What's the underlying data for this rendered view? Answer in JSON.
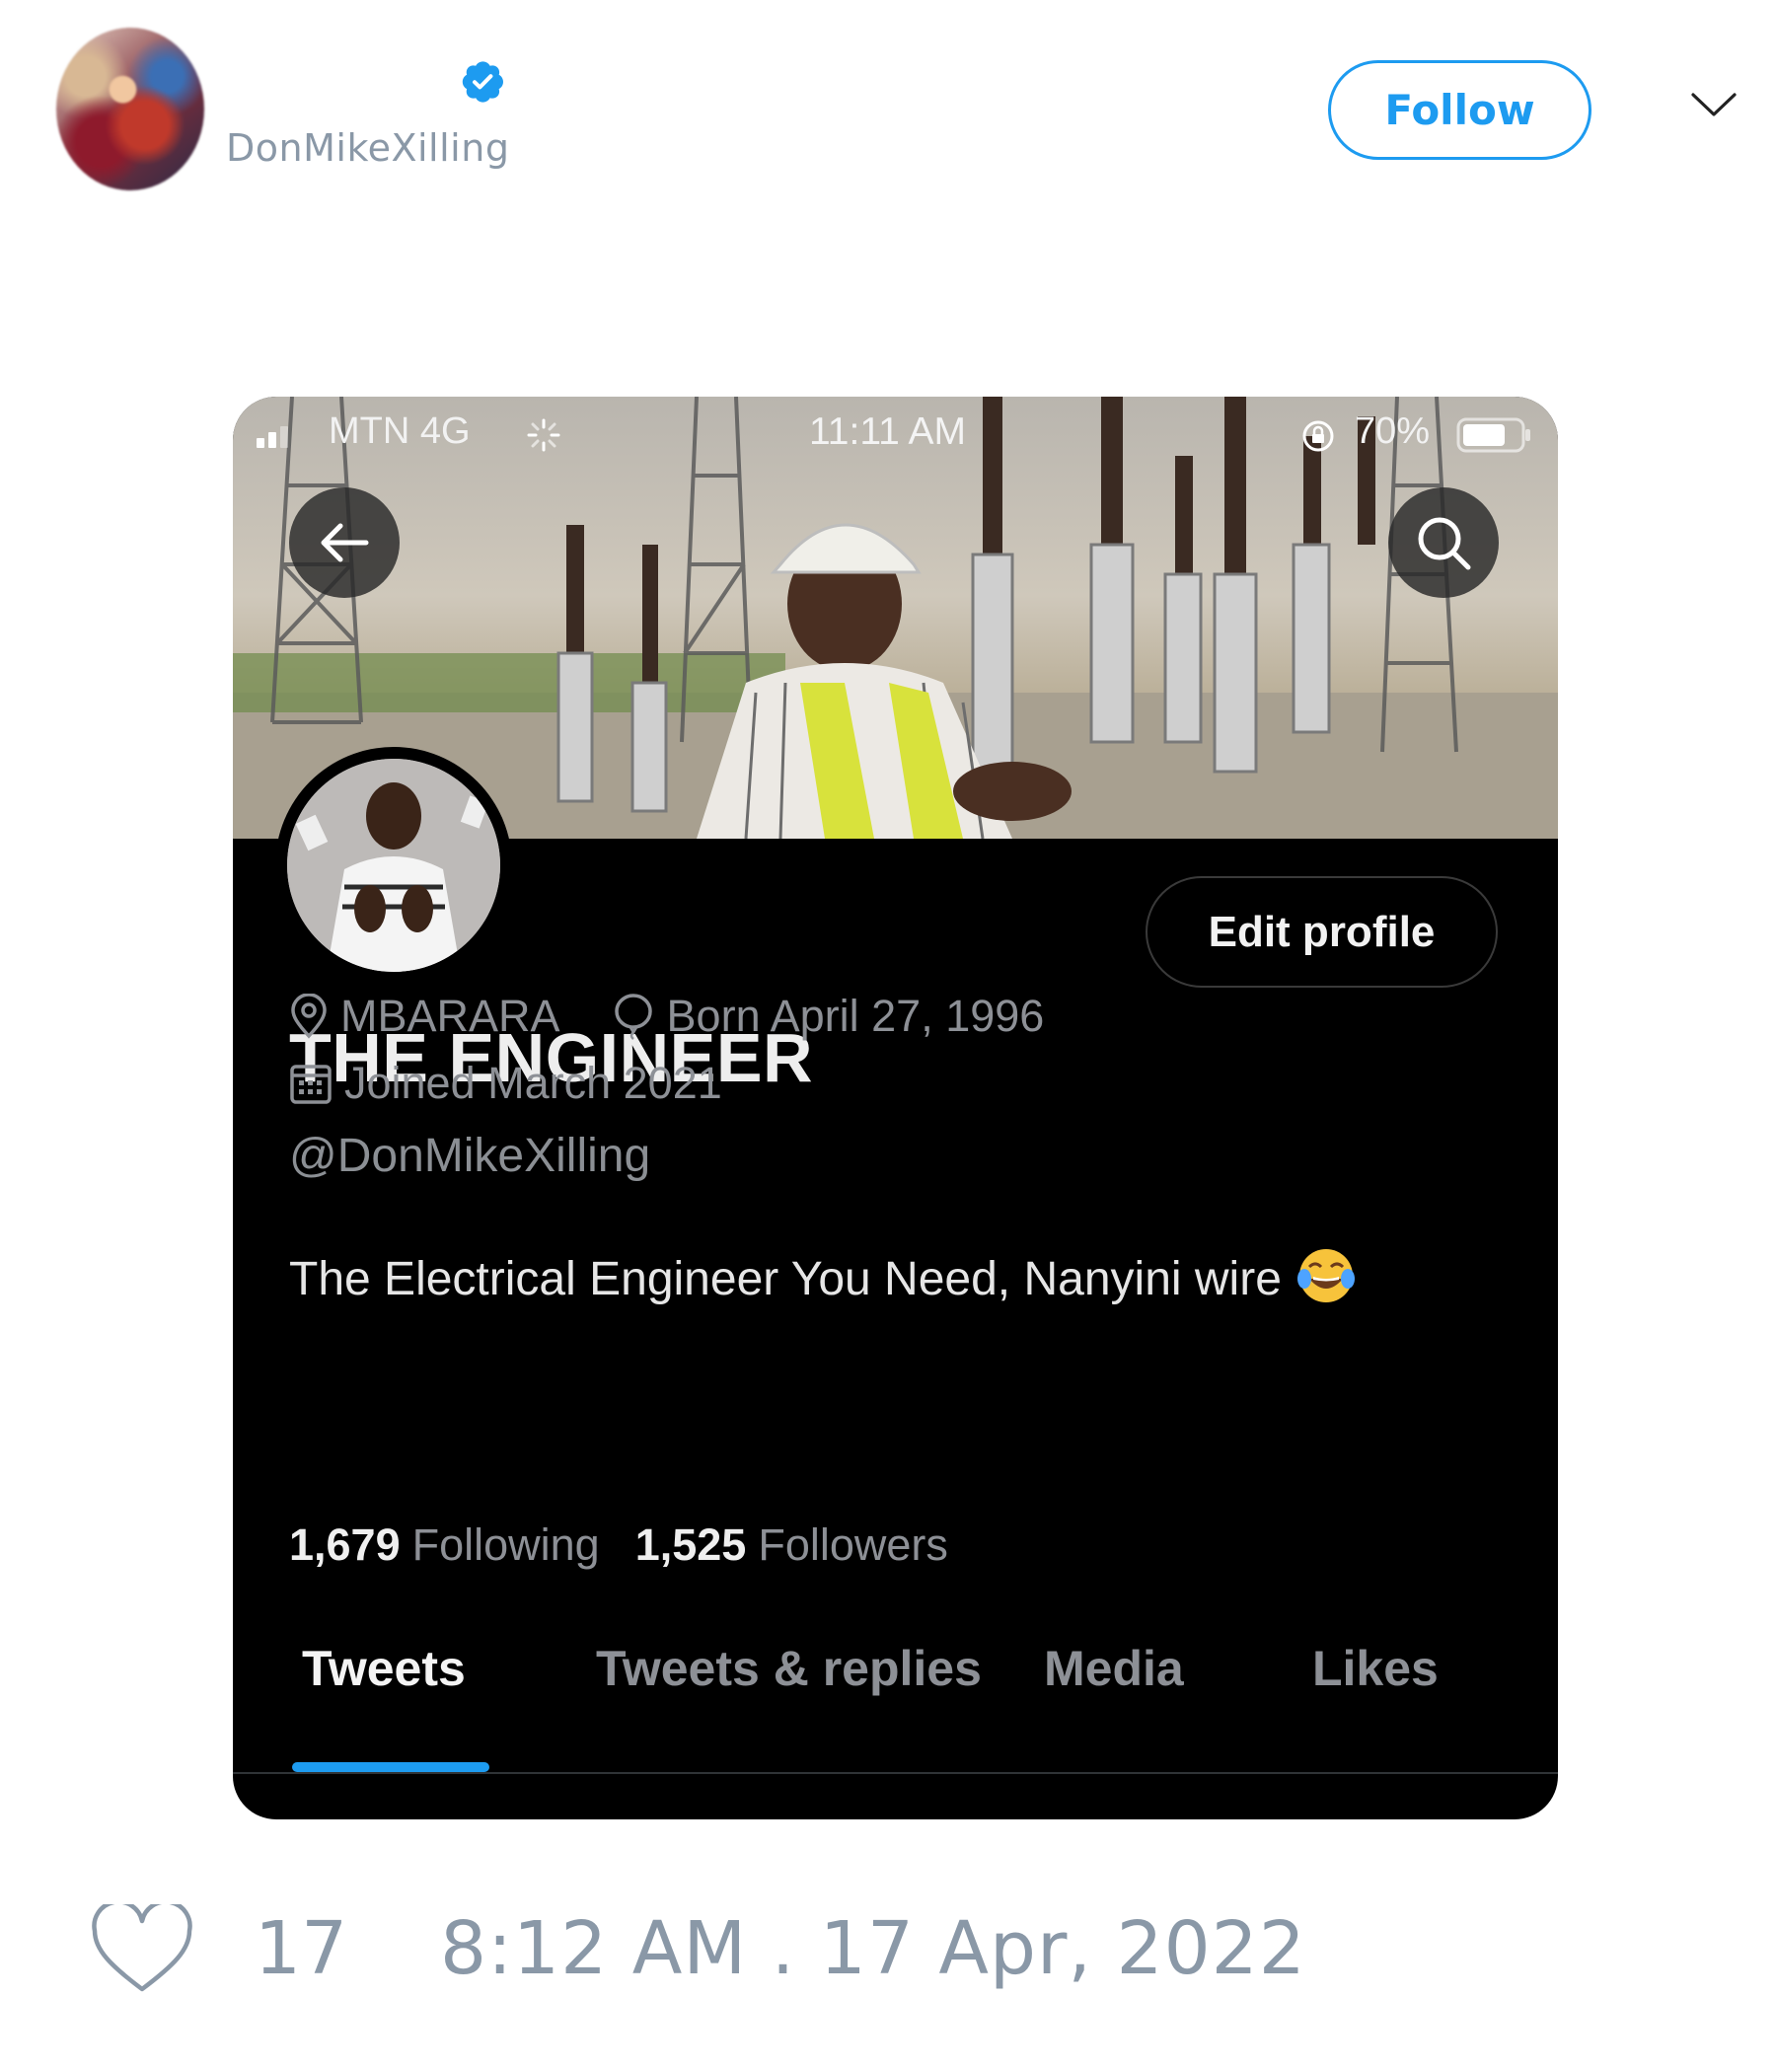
{
  "tweet": {
    "author_handle": "DonMikeXilling",
    "follow_label": "Follow",
    "like_count": "17",
    "timestamp": "8:12 AM . 17 Apr, 2022"
  },
  "status_bar": {
    "carrier": "MTN  4G",
    "time": "11:11 AM",
    "battery": "70%"
  },
  "profile": {
    "edit_label": "Edit profile",
    "name": "THE ENGINEER",
    "handle": "@DonMikeXilling",
    "bio": "The Electrical Engineer You Need, Nanyini wire",
    "location": "MBARARA",
    "birthday": "Born April 27, 1996",
    "joined": "Joined March 2021",
    "following_count": "1,679",
    "following_label": "Following",
    "followers_count": "1,525",
    "followers_label": "Followers"
  },
  "tabs": [
    {
      "label": "Tweets"
    },
    {
      "label": "Tweets & replies"
    },
    {
      "label": "Media"
    },
    {
      "label": "Likes"
    }
  ],
  "colors": {
    "accent": "#1d9bf0",
    "muted_text": "#8a98a7",
    "dark_bg": "#000000"
  }
}
